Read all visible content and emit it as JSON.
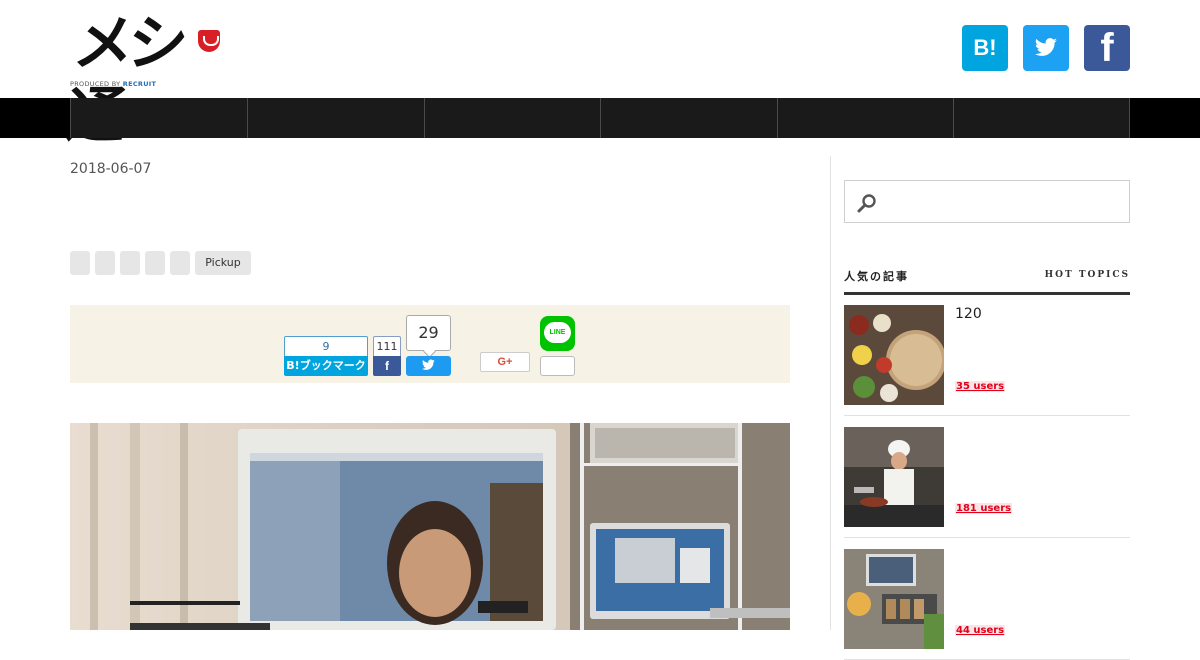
{
  "header": {
    "logo_text": "メシ通",
    "logo_credit_prefix": "PRODUCED BY ",
    "logo_credit_brand": "RECRUIT",
    "social": [
      {
        "name": "hatena-bookmark",
        "label": "B!",
        "color": "#00a4de"
      },
      {
        "name": "twitter",
        "label": "",
        "color": "#1da1f2"
      },
      {
        "name": "facebook",
        "label": "f",
        "color": "#3b5998"
      }
    ]
  },
  "nav": {
    "items": [
      "",
      "",
      "",
      "",
      "",
      ""
    ],
    "background": "#000000",
    "item_background": "#1a1a1a"
  },
  "article": {
    "date": "2018-06-07",
    "tags": [
      "",
      "",
      "",
      "",
      "",
      "Pickup"
    ],
    "share": {
      "hatena_count": "9",
      "hatena_label": "B!ブックマーク",
      "facebook_count": "111",
      "facebook_label": "f",
      "twitter_count": "29",
      "google_plus_label": "G+",
      "line_label": "LINE",
      "line_count": "",
      "background": "#f6f3e6"
    }
  },
  "sidebar": {
    "search": {
      "placeholder": "",
      "icon": "search-icon"
    },
    "section_title": "人気の記事",
    "section_subtitle": "HOT TOPICS",
    "topics": [
      {
        "title": "120",
        "users": "35 users"
      },
      {
        "title": "",
        "users": "181 users"
      },
      {
        "title": "",
        "users": "44 users"
      }
    ],
    "users_color": "#e2001a"
  }
}
